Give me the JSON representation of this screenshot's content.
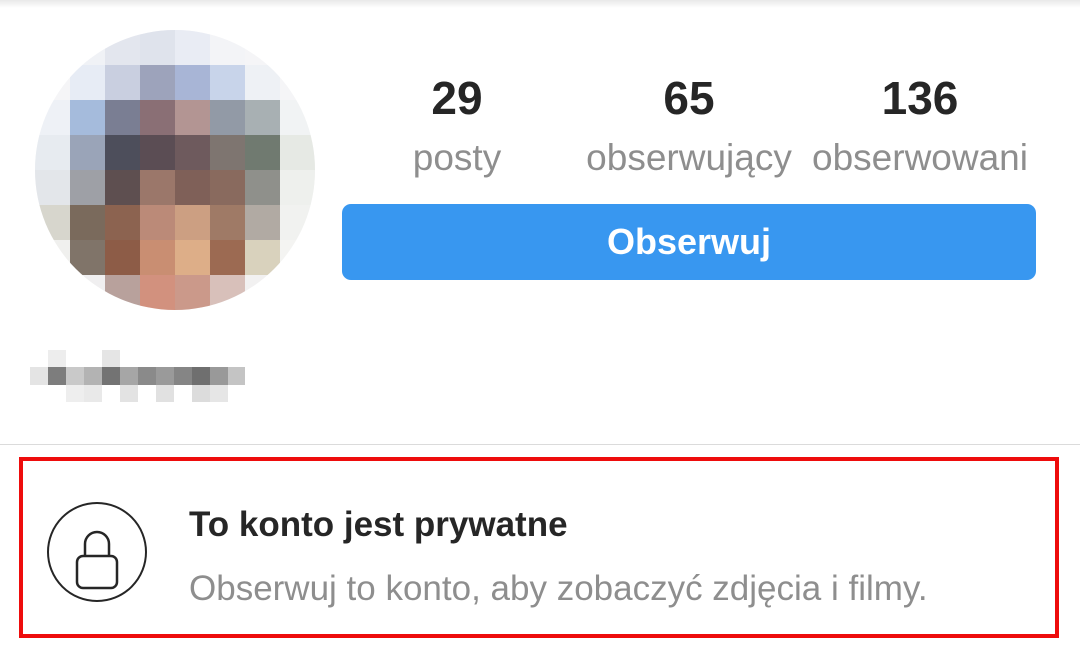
{
  "profile": {
    "stats": [
      {
        "count": "29",
        "label": "posty"
      },
      {
        "count": "65",
        "label": "obserwujący"
      },
      {
        "count": "136",
        "label": "obserwowani"
      }
    ],
    "follow_label": "Obserwuj",
    "avatar_icon": "blurred-profile-photo",
    "username_icon": "blurred-username"
  },
  "private_notice": {
    "title": "To konto jest prywatne",
    "subtitle": "Obserwuj to konto, aby zobaczyć zdjęcia i filmy.",
    "icon": "lock-icon",
    "highlight_color": "#ee0c0c"
  },
  "colors": {
    "accent": "#3897f0",
    "text_primary": "#262626",
    "text_secondary": "#8e8e8e"
  }
}
